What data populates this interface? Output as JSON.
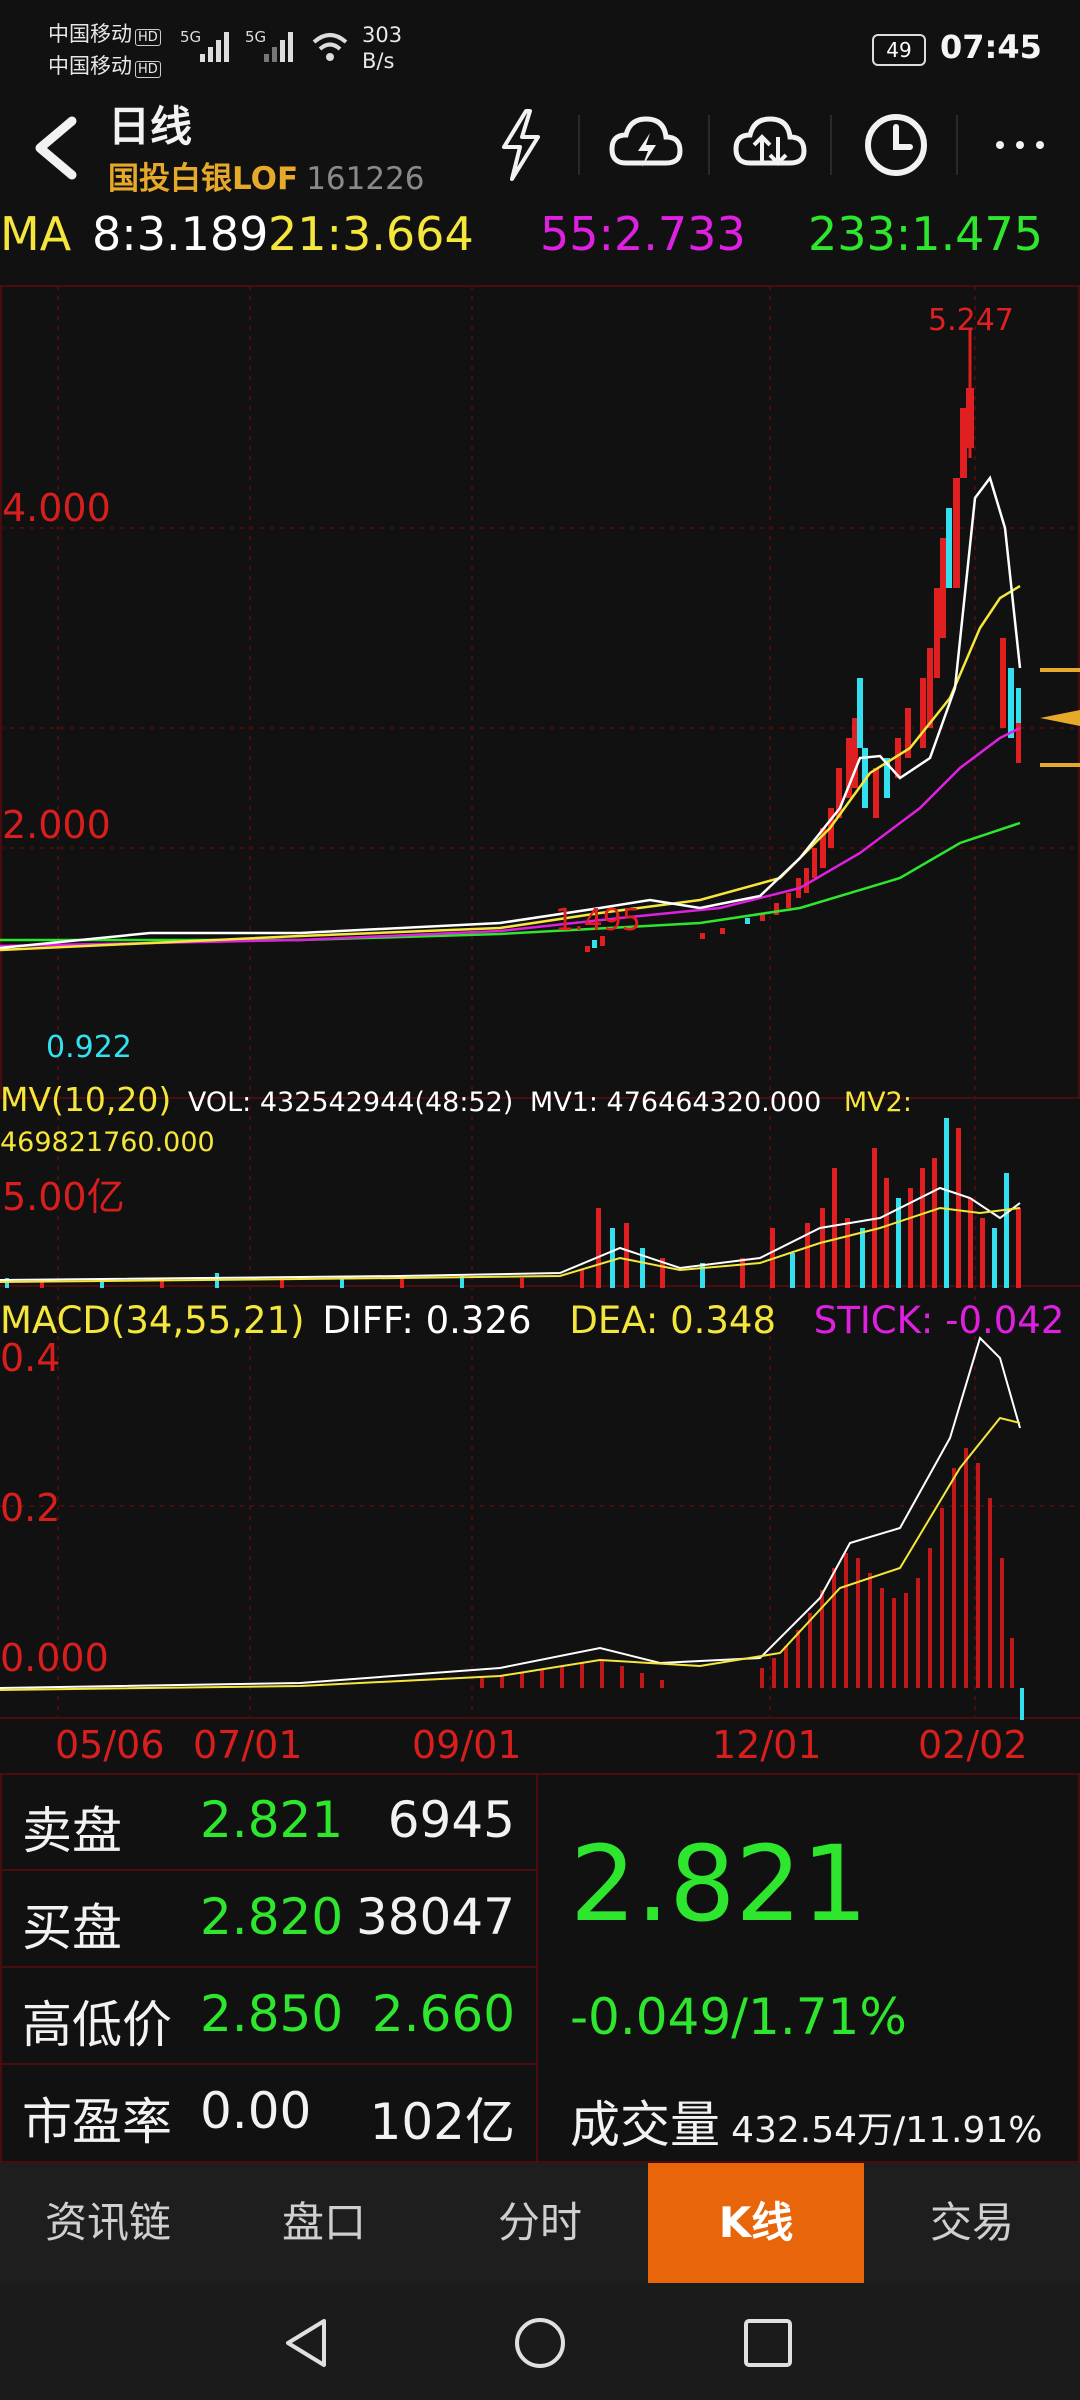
{
  "status_bar": {
    "carrier1": "中国移动",
    "carrier2": "中国移动",
    "hd": "HD",
    "net": "5G",
    "speed_value": "303",
    "speed_unit": "B/s",
    "battery": "49",
    "time": "07:45"
  },
  "header": {
    "title": "日线",
    "name": "国投白银LOF",
    "code": "161226"
  },
  "ma": {
    "label": "MA",
    "ma8": "8:3.189",
    "ma21": "21:3.664",
    "ma55": "55:2.733",
    "ma233": "233:1.475"
  },
  "kline": {
    "y_labels": [
      "4.000",
      "2.000"
    ],
    "high_label": "5.247",
    "mid_label": "1.495",
    "low_label": "0.922"
  },
  "volume": {
    "label": "MV(10,20)",
    "vol": "VOL: 432542944(48:52)",
    "mv1": "MV1: 476464320.000",
    "mv2": "MV2: 469821760.000",
    "y_label": "5.00亿"
  },
  "macd": {
    "label": "MACD(34,55,21)",
    "diff": "DIFF: 0.326",
    "dea": "DEA: 0.348",
    "stick": "STICK: -0.042",
    "y_labels": [
      "0.4",
      "0.2",
      "0.000"
    ]
  },
  "x_axis": [
    "05/06",
    "07/01",
    "09/01",
    "12/01",
    "02/02"
  ],
  "quote": {
    "sell": {
      "label": "卖盘",
      "price": "2.821",
      "qty": "6945"
    },
    "buy": {
      "label": "买盘",
      "price": "2.820",
      "qty": "38047"
    },
    "range": {
      "label": "高低价",
      "high": "2.850",
      "low": "2.660"
    },
    "pe": {
      "label": "市盈率",
      "value": "0.00",
      "cap": "102亿"
    },
    "price": "2.821",
    "change": "-0.049/1.71%",
    "turnover_label": "成交量",
    "turnover_value": "432.54万/11.91%"
  },
  "tabs": [
    "资讯链",
    "盘口",
    "分时",
    "K线",
    "交易"
  ],
  "colors": {
    "up": "#e02020",
    "down": "#33e0f0",
    "green": "#2ee62e",
    "yellow": "#f5e63c",
    "magenta": "#e020e0",
    "accent": "#e8650a"
  }
}
